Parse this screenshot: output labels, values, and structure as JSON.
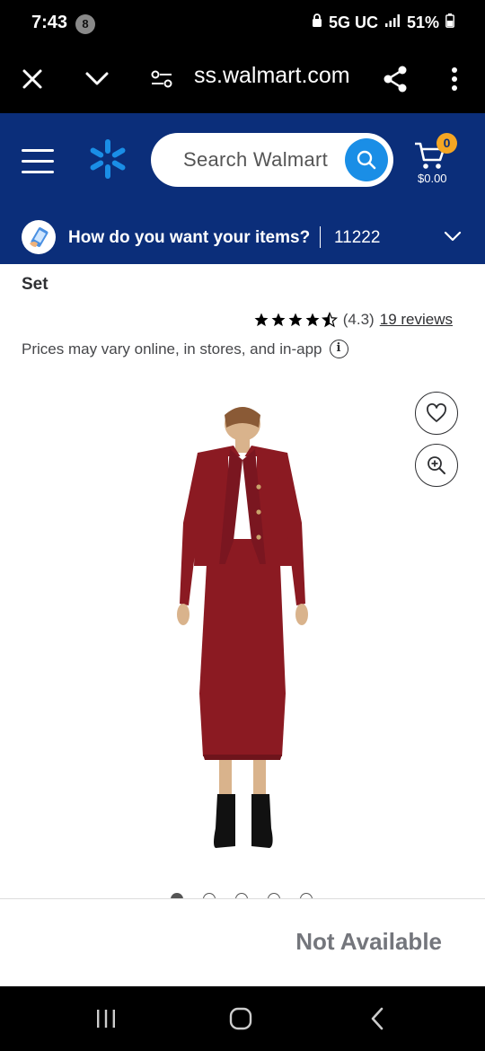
{
  "status_bar": {
    "time": "7:43",
    "notification_count": "8",
    "network": "5G UC",
    "battery": "51%"
  },
  "browser": {
    "url": "ss.walmart.com"
  },
  "header": {
    "search_placeholder": "Search Walmart",
    "cart_count": "0",
    "cart_total": "$0.00",
    "delivery_prompt": "How do you want your items?",
    "zip": "11222"
  },
  "product": {
    "title_fragment": "Set",
    "rating_value": "(4.3)",
    "reviews": "19 reviews",
    "stars_filled": 4.3,
    "prices_note": "Prices may vary online, in stores, and in-app",
    "image_count": 5,
    "active_image": 1,
    "availability": "Not Available"
  },
  "colors": {
    "brand_blue": "#0b2e7a",
    "accent_blue": "#1a8ee6",
    "spark_yellow": "#f5a623",
    "product_red": "#8b1a22"
  }
}
